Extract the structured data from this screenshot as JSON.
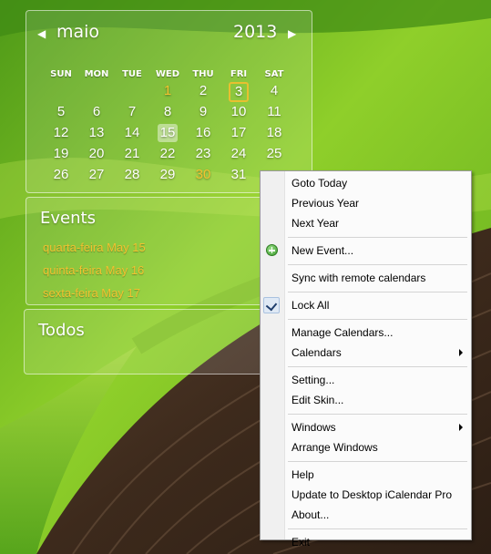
{
  "colors": {
    "accent_yellow": "#f2c230",
    "menu_background": "#fbfbfb"
  },
  "calendar": {
    "prev_icon": "triangle-left",
    "next_icon": "triangle-right",
    "month": "maio",
    "year": "2013",
    "weekdays": [
      "SUN",
      "MON",
      "TUE",
      "WED",
      "THU",
      "FRI",
      "SAT"
    ],
    "weeks": [
      [
        "",
        "",
        "",
        "1",
        "2",
        "3",
        "4"
      ],
      [
        "5",
        "6",
        "7",
        "8",
        "9",
        "10",
        "11"
      ],
      [
        "12",
        "13",
        "14",
        "15",
        "16",
        "17",
        "18"
      ],
      [
        "19",
        "20",
        "21",
        "22",
        "23",
        "24",
        "25"
      ],
      [
        "26",
        "27",
        "28",
        "29",
        "30",
        "31",
        ""
      ]
    ],
    "highlighted_days": [
      "1",
      "30"
    ],
    "boxed_day": "3",
    "selected_day": "15"
  },
  "events": {
    "title": "Events",
    "items": [
      "quarta-feira May 15",
      "quinta-feira May 16",
      "sexta-feira May 17"
    ]
  },
  "todos": {
    "title": "Todos"
  },
  "context_menu": {
    "items": [
      {
        "label": "Goto Today"
      },
      {
        "label": "Previous Year"
      },
      {
        "label": "Next Year"
      },
      {
        "sep": true
      },
      {
        "label": "New Event...",
        "icon": "add-icon"
      },
      {
        "sep": true
      },
      {
        "label": "Sync with remote calendars"
      },
      {
        "sep": true
      },
      {
        "label": "Lock All",
        "checked": true
      },
      {
        "sep": true
      },
      {
        "label": "Manage Calendars..."
      },
      {
        "label": "Calendars",
        "submenu": true
      },
      {
        "sep": true
      },
      {
        "label": "Setting..."
      },
      {
        "label": "Edit Skin..."
      },
      {
        "sep": true
      },
      {
        "label": "Windows",
        "submenu": true
      },
      {
        "label": "Arrange Windows"
      },
      {
        "sep": true
      },
      {
        "label": "Help"
      },
      {
        "label": "Update to Desktop iCalendar Pro"
      },
      {
        "label": "About..."
      },
      {
        "sep": true
      },
      {
        "label": "Exit"
      }
    ]
  }
}
